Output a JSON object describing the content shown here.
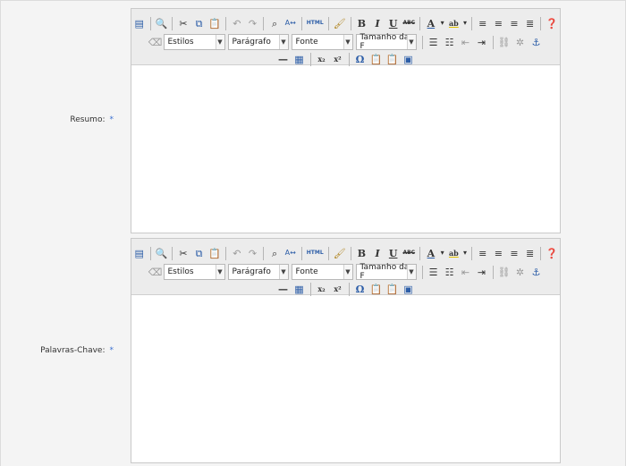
{
  "form": {
    "fields": [
      {
        "label": "Resumo:",
        "required_mark": "*",
        "toolbar": {
          "styles_select": "Estilos",
          "format_select": "Parágrafo",
          "font_select": "Fonte",
          "size_select": "Tamanho da F"
        }
      },
      {
        "label": "Palavras-Chave:",
        "required_mark": "*",
        "toolbar": {
          "styles_select": "Estilos",
          "format_select": "Parágrafo",
          "font_select": "Fonte",
          "size_select": "Tamanho da F"
        }
      }
    ]
  },
  "toolbar_buttons": {
    "html_label": "HTML",
    "bold": "B",
    "italic": "I",
    "underline": "U",
    "strike": "ABC",
    "font_color": "A",
    "highlight": "ab",
    "subscript": "x₂",
    "superscript": "x²",
    "special_char": "Ω"
  },
  "colors": {
    "accent": "#3a6fd0",
    "toolbar_bg": "#ececec",
    "page_bg": "#f4f4f4"
  }
}
